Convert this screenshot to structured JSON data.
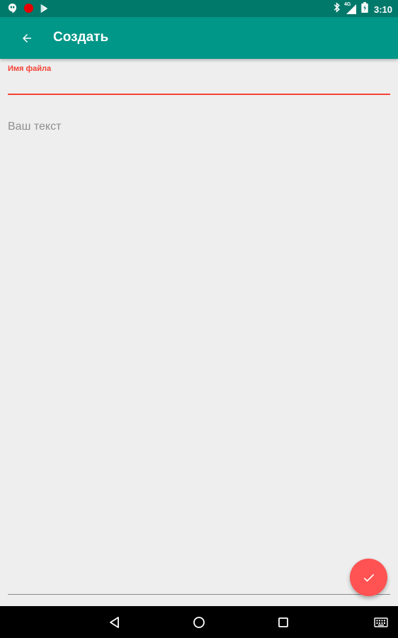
{
  "status_bar": {
    "time": "3:10",
    "network_label": "4G",
    "icons": [
      "hangouts-icon",
      "record-icon",
      "play-store-icon",
      "bluetooth-icon",
      "signal-icon",
      "battery-icon"
    ]
  },
  "app_bar": {
    "title": "Создать",
    "back_icon": "arrow-left-icon"
  },
  "form": {
    "filename_label": "Имя файла",
    "filename_value": "",
    "body_placeholder": "Ваш текст",
    "body_value": ""
  },
  "fab": {
    "icon": "check-icon"
  },
  "nav_bar": {
    "icons": [
      "back-triangle-icon",
      "home-circle-icon",
      "recents-square-icon",
      "keyboard-icon"
    ]
  },
  "colors": {
    "primary": "#009688",
    "primary_dark": "#00796b",
    "accent": "#ff5252",
    "error": "#f44336",
    "background": "#eeeeee"
  }
}
